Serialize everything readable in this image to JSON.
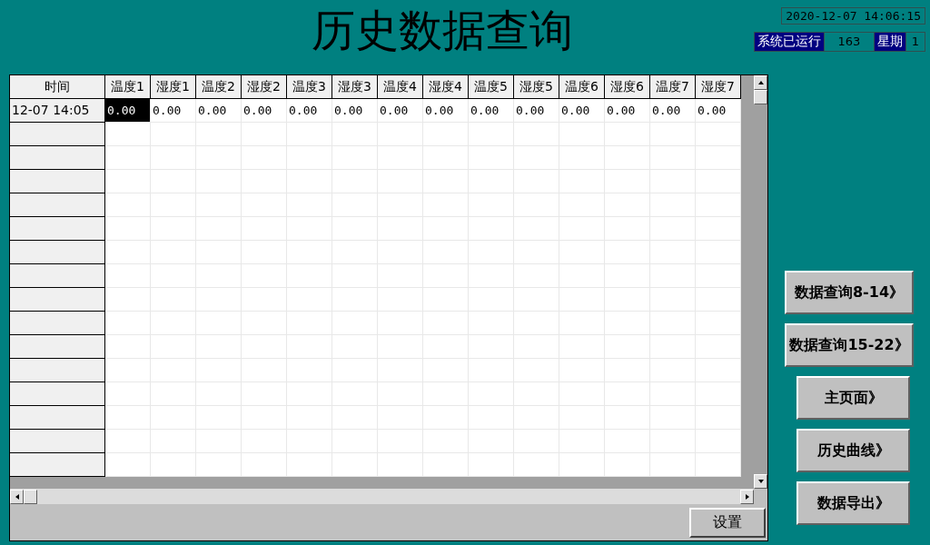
{
  "title": "历史数据查询",
  "clock": "2020-12-07 14:06:15",
  "status": {
    "run_label": "系统已运行",
    "run_value": "163",
    "week_label": "星期",
    "week_value": "1"
  },
  "table": {
    "columns": [
      "时间",
      "温度1",
      "湿度1",
      "温度2",
      "湿度2",
      "温度3",
      "湿度3",
      "温度4",
      "湿度4",
      "温度5",
      "湿度5",
      "温度6",
      "湿度6",
      "温度7",
      "湿度7"
    ],
    "rows": [
      {
        "cells": [
          {
            "value": "12-07 14:05",
            "selected": false
          },
          {
            "value": "0.00",
            "selected": true
          },
          {
            "value": "0.00",
            "selected": false
          },
          {
            "value": "0.00",
            "selected": false
          },
          {
            "value": "0.00",
            "selected": false
          },
          {
            "value": "0.00",
            "selected": false
          },
          {
            "value": "0.00",
            "selected": false
          },
          {
            "value": "0.00",
            "selected": false
          },
          {
            "value": "0.00",
            "selected": false
          },
          {
            "value": "0.00",
            "selected": false
          },
          {
            "value": "0.00",
            "selected": false
          },
          {
            "value": "0.00",
            "selected": false
          },
          {
            "value": "0.00",
            "selected": false
          },
          {
            "value": "0.00",
            "selected": false
          },
          {
            "value": "0.00",
            "selected": false
          }
        ]
      }
    ]
  },
  "settings_button": "设置",
  "nav_buttons": [
    {
      "label": "数据查询8-14》",
      "kind": "wide"
    },
    {
      "label": "数据查询15-22》",
      "kind": "wide"
    },
    {
      "label": "主页面》",
      "kind": "narrow"
    },
    {
      "label": "历史曲线》",
      "kind": "narrow"
    },
    {
      "label": "数据导出》",
      "kind": "narrow"
    }
  ]
}
